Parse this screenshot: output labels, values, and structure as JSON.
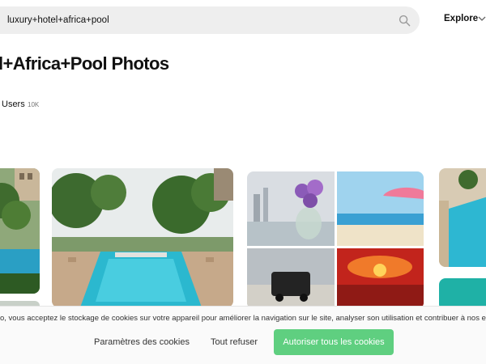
{
  "search": {
    "value": "luxury+hotel+africa+pool"
  },
  "nav": {
    "explore_label": "Explore"
  },
  "page": {
    "title": "l+Africa+Pool Photos"
  },
  "tabs": [
    {
      "label": "Users",
      "count": "10K"
    }
  ],
  "cookie_banner": {
    "text": "o, vous acceptez le stockage de cookies sur votre appareil pour améliorer la navigation sur le site, analyser son utilisation et contribuer à nos ef",
    "settings_label": "Paramètres des cookies",
    "refuse_label": "Tout refuser",
    "accept_label": "Autoriser tous les cookies"
  },
  "colors": {
    "accent_green": "#5fcf80",
    "search_bg": "#eeeeee",
    "pool_blue": "#2bb8cf"
  },
  "icons": [
    "search-icon",
    "chevron-down-icon"
  ]
}
